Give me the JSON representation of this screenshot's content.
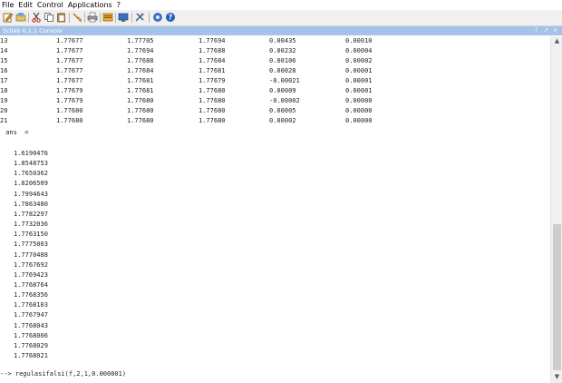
{
  "menu": [
    "File",
    "Edit",
    "Control",
    "Applications",
    "?"
  ],
  "console": {
    "title": "Scilab 6.1.1 Console",
    "controls": [
      "?",
      "↗",
      "×"
    ],
    "rows": [
      [
        "13",
        "1.77677",
        "1.77705",
        "1.77694",
        "0.00435",
        "0.00010"
      ],
      [
        "14",
        "1.77677",
        "1.77694",
        "1.77688",
        "0.00232",
        "0.00004"
      ],
      [
        "15",
        "1.77677",
        "1.77688",
        "1.77684",
        "0.00106",
        "0.00002"
      ],
      [
        "16",
        "1.77677",
        "1.77684",
        "1.77681",
        "0.00028",
        "0.00001"
      ],
      [
        "17",
        "1.77677",
        "1.77681",
        "1.77679",
        "-0.00021",
        "0.00001"
      ],
      [
        "18",
        "1.77679",
        "1.77681",
        "1.77680",
        "0.00009",
        "0.00001"
      ],
      [
        "19",
        "1.77679",
        "1.77680",
        "1.77680",
        "-0.00002",
        "0.00000"
      ],
      [
        "20",
        "1.77680",
        "1.77680",
        "1.77680",
        "0.00005",
        "0.00000"
      ],
      [
        "21",
        "1.77680",
        "1.77680",
        "1.77680",
        "0.00002",
        "0.00000"
      ]
    ],
    "ans_label": " ans  =",
    "ans_values": [
      "1.6190476",
      "1.8548753",
      "1.7650362",
      "1.8206509",
      "1.7994643",
      "1.7863480",
      "1.7782297",
      "1.7732036",
      "1.7763150",
      "1.7775003",
      "1.7770488",
      "1.7767692",
      "1.7769423",
      "1.7768764",
      "1.7768356",
      "1.7768103",
      "1.7767947",
      "1.7768043",
      "1.7768006",
      "1.7768029",
      "1.7768021"
    ],
    "prompt": "--> regulasifalsi(f,2,1,0.000001)"
  },
  "colors": {
    "title_bar": "#a3c4e8",
    "toolbar": "#f0f0f0"
  },
  "toolbar_icons": [
    "new-script-icon",
    "open-folder-icon",
    "cut-icon",
    "copy-icon",
    "paste-icon",
    "clear-console-icon",
    "print-icon",
    "variable-browser-icon",
    "file-browser-icon",
    "xcos-icon",
    "help-icon",
    "demos-icon",
    "help-browser-icon"
  ]
}
